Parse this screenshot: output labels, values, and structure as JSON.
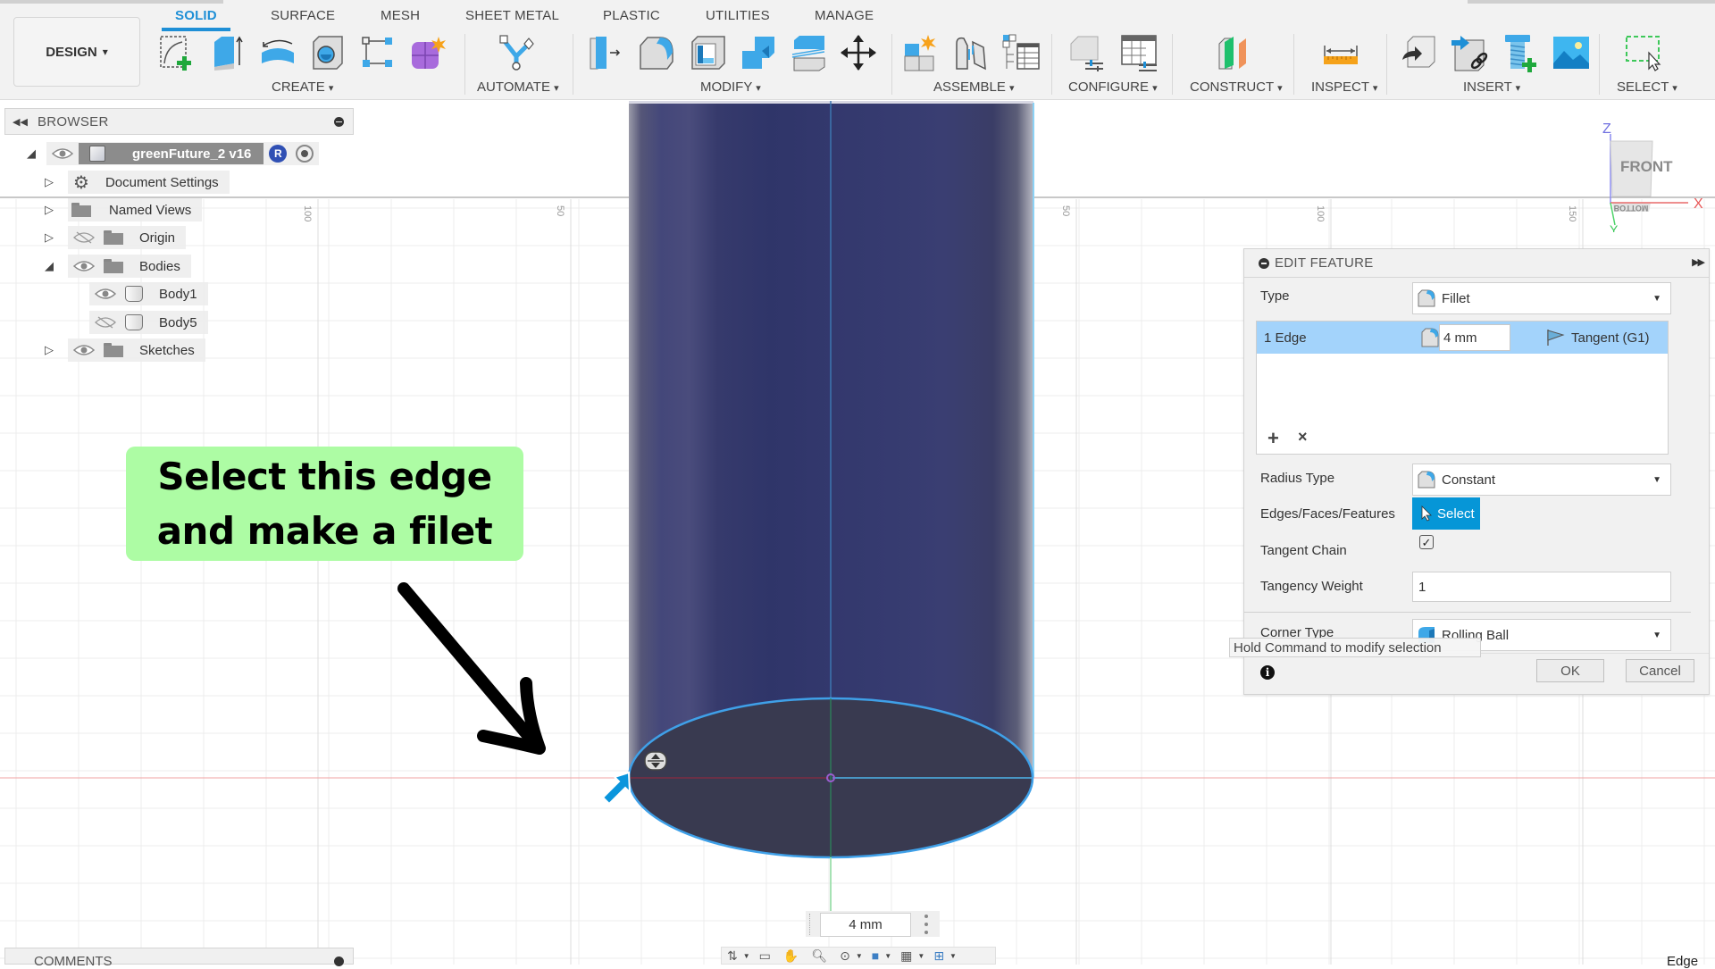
{
  "toolbar": {
    "workspace_button": "DESIGN",
    "tabs": [
      {
        "label": "SOLID",
        "active": true
      },
      {
        "label": "SURFACE",
        "active": false
      },
      {
        "label": "MESH",
        "active": false
      },
      {
        "label": "SHEET METAL",
        "active": false
      },
      {
        "label": "PLASTIC",
        "active": false
      },
      {
        "label": "UTILITIES",
        "active": false
      },
      {
        "label": "MANAGE",
        "active": false
      }
    ],
    "groups": [
      {
        "label": "CREATE",
        "tools": [
          "create-sketch-icon",
          "extrude-icon",
          "revolve-icon",
          "hole-icon",
          "rectangular-pattern-icon",
          "create-form-icon"
        ]
      },
      {
        "label": "AUTOMATE",
        "tools": [
          "automate-icon"
        ]
      },
      {
        "label": "MODIFY",
        "tools": [
          "press-pull-icon",
          "fillet-icon",
          "shell-icon",
          "combine-icon",
          "split-body-icon",
          "move-icon"
        ]
      },
      {
        "label": "ASSEMBLE",
        "tools": [
          "new-component-icon",
          "joint-icon",
          "bom-table-icon"
        ]
      },
      {
        "label": "CONFIGURE",
        "tools": [
          "configure-icon",
          "configure-table-icon"
        ]
      },
      {
        "label": "CONSTRUCT",
        "tools": [
          "offset-plane-icon"
        ]
      },
      {
        "label": "INSPECT",
        "tools": [
          "measure-icon"
        ]
      },
      {
        "label": "INSERT",
        "tools": [
          "insert-derive-icon",
          "insert-link-icon",
          "insert-mcmaster-icon",
          "insert-canvas-icon"
        ]
      },
      {
        "label": "SELECT",
        "tools": [
          "window-select-icon"
        ]
      }
    ],
    "dropdown_glyph": "▾"
  },
  "browser": {
    "title": "BROWSER",
    "root": {
      "label": "greenFuture_2 v16",
      "badge": "R"
    },
    "items": [
      {
        "label": "Document Settings",
        "icon": "gear-icon",
        "expanded": false,
        "visible": null
      },
      {
        "label": "Named Views",
        "icon": "folder-icon",
        "expanded": false,
        "visible": null
      },
      {
        "label": "Origin",
        "icon": "folder-icon",
        "expanded": false,
        "visible": false
      },
      {
        "label": "Bodies",
        "icon": "folder-icon",
        "expanded": true,
        "visible": true
      },
      {
        "label": "Body1",
        "icon": "body-icon",
        "expanded": null,
        "visible": true
      },
      {
        "label": "Body5",
        "icon": "body-icon",
        "expanded": null,
        "visible": false
      },
      {
        "label": "Sketches",
        "icon": "folder-icon",
        "expanded": false,
        "visible": true
      }
    ]
  },
  "callout": {
    "line1": "Select this edge",
    "line2": "and make a filet",
    "color": "#adfca4"
  },
  "viewport": {
    "ruler_labels": [
      "100",
      "50",
      "50",
      "100",
      "150"
    ],
    "body_color": "#33386d",
    "selection_color": "#0696d7"
  },
  "viewcube": {
    "face": "FRONT",
    "bottom_face": "BOTTOM",
    "axes": {
      "z": "Z",
      "x": "X",
      "y": "Y"
    }
  },
  "edit_feature": {
    "title": "EDIT FEATURE",
    "type_label": "Type",
    "type_value": "Fillet",
    "edge_row": {
      "name": "1 Edge",
      "radius": "4 mm",
      "continuity": "Tangent (G1)"
    },
    "radius_type_label": "Radius Type",
    "radius_type_value": "Constant",
    "edges_label": "Edges/Faces/Features",
    "select_button": "Select",
    "tangent_chain_label": "Tangent Chain",
    "tangent_chain_checked": true,
    "tangent_chain_mark": "✓",
    "tangency_weight_label": "Tangency Weight",
    "tangency_weight_value": "1",
    "corner_type_label": "Corner Type",
    "corner_type_value": "Rolling Ball",
    "ok_button": "OK",
    "cancel_button": "Cancel",
    "add_glyph": "+",
    "remove_glyph": "×",
    "info_glyph": "i"
  },
  "tooltip": "Hold Command to modify selection",
  "dimension_input": "4 mm",
  "comments": {
    "title": "COMMENTS"
  },
  "status_hint": "Edge"
}
